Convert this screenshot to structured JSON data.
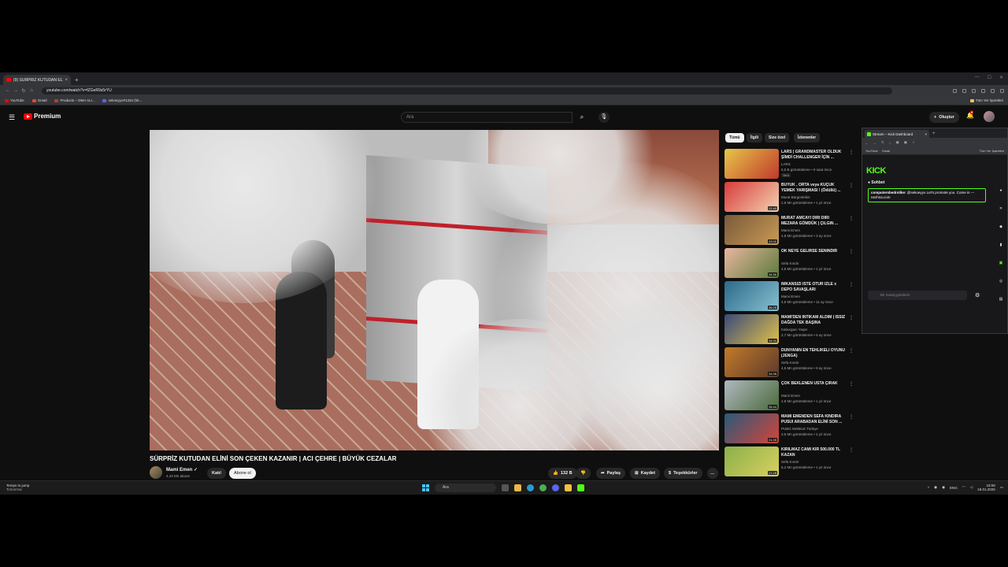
{
  "browser": {
    "tab_title": "(9) SÜRPRİZ KUTUDAN ELİ...",
    "url": "youtube.com/watch?v=fZGeR9s5rYU",
    "bookmarks": [
      "YouTube",
      "Gmail",
      "Products – DMA ALI...",
      "sekoeyyo#1334 (hit..."
    ],
    "bookmarks_right": "Tüm Yer İşaretleri"
  },
  "header": {
    "logo_text": "Premium",
    "search_placeholder": "Ara",
    "create_label": "Oluştur",
    "notif_count": "9"
  },
  "video": {
    "title": "SÜRPRİZ KUTUDAN ELİNİ SON ÇEKEN KAZANIR | ACI ÇEHRE | BÜYÜK CEZALAR",
    "channel": "Mami Emen",
    "subscribers": "4,43 Mn abone",
    "join_label": "Katıl",
    "subscribe_label": "Abone ol",
    "likes": "132 B",
    "share_label": "Paylaş",
    "save_label": "Kaydet",
    "thanks_label": "Teşekkürler"
  },
  "chips": [
    "Tümü",
    "İlgili",
    "Size özel",
    "İzlenenler"
  ],
  "recommendations": [
    {
      "title": "LARS | GRANDMASTER OLDUK ŞİMDİ CHALLENGER İÇİN ...",
      "channel": "LARS",
      "meta": "5,5 B görüntüleme • 9 saat önce",
      "badge": "Yeni",
      "duration": "",
      "colors": [
        "#e8c64a",
        "#c0392b"
      ]
    },
    {
      "title": "BÜYÜK , ORTA veya KÜÇÜK YEMEK YARIŞMASI ! (Ödüllü) ...",
      "channel": "Murat Bürgenlekin",
      "meta": "2,9 Mn görüntüleme • 1 yıl önce",
      "badge": "",
      "duration": "22:40",
      "colors": [
        "#d93b3b",
        "#f2d2b0"
      ]
    },
    {
      "title": "MURAT AMCAYI DİRİ DİRİ MEZARA GÖMDÜK | ÇILGIN ...",
      "channel": "Mami Emen",
      "meta": "4,8 Mn görüntüleme • 3 ay önce",
      "badge": "",
      "duration": "43:11",
      "colors": [
        "#7a5a3a",
        "#c99a55"
      ]
    },
    {
      "title": "OK NEYE GELİRSE SENİNDİR",
      "channel": "Sefa Kındır",
      "meta": "4,8 Mn görüntüleme • 1 yıl önce",
      "badge": "",
      "duration": "34:56",
      "colors": [
        "#e9b7a0",
        "#5a7a3a"
      ]
    },
    {
      "title": "İMKANSIZI İSTE OTUR İZLE x DEPO SAVAŞLARI",
      "channel": "Mami Emen",
      "meta": "4,5 Mn görüntüleme • 11 ay önce",
      "badge": "",
      "duration": "36:29",
      "colors": [
        "#2a6a8a",
        "#88c0d0"
      ]
    },
    {
      "title": "MAMİ'DEN İNTİKAM ALDIM | ISSIZ DAĞDA TEK BAŞINA",
      "channel": "Kaburgacı Yaşar",
      "meta": "2,7 Mn görüntüleme • 6 ay önce",
      "badge": "",
      "duration": "34:04",
      "colors": [
        "#3a4a7a",
        "#e2c14a"
      ]
    },
    {
      "title": "DÜNYANIN EN TEHLİKELİ OYUNU (JENGA)",
      "channel": "Sefa Kındır",
      "meta": "4,5 Mn görüntüleme • 9 ay önce",
      "badge": "",
      "duration": "34:08",
      "colors": [
        "#c47a2a",
        "#5a3a2a"
      ]
    },
    {
      "title": "ÇOK BEKLENEN USTA ÇIRAK",
      "channel": "Mami Emen",
      "meta": "4,9 Mn görüntüleme • 1 yıl önce",
      "badge": "",
      "duration": "36:44",
      "colors": [
        "#b0b8c0",
        "#4a6a3a"
      ]
    },
    {
      "title": "MAMİ EMENDEN SEFA KINDIRA PUSUI ARABADAN ELİNİ SON ...",
      "channel": "PUBG MOBILE Türkiye",
      "meta": "3,5 Mn görüntüleme • 2 yıl önce",
      "badge": "",
      "duration": "31:05",
      "colors": [
        "#2a5a7a",
        "#d4443a"
      ]
    },
    {
      "title": "KIRILMAZ CAMI KIR 500.000 TL KAZAN",
      "channel": "Sefa Kındır",
      "meta": "5,2 Mn görüntüleme • 1 yıl önce",
      "badge": "",
      "duration": "21:28",
      "colors": [
        "#8ab04a",
        "#d9d060"
      ]
    }
  ],
  "kick": {
    "tab_title": "Stream – Kick Dashboard",
    "logo": "KICK",
    "chat_header": "Sohbet",
    "message_user": "computersbedrolike:",
    "message_text": "@sekoeyyo Let's promote you. Come in ---nezhna.com",
    "input_placeholder": "Bir mesaj gönderin",
    "bookmarks": [
      "YouTube",
      "Gmail"
    ],
    "bookmarks_right": "Tüm Yer İşaretleri"
  },
  "taskbar": {
    "weather_line1": "Temps to jump",
    "weather_line2": "Tomorrow",
    "search_placeholder": "Ara",
    "lang": "ENG",
    "time": "18:08",
    "date": "18.01.2026"
  },
  "colors": {
    "yt_bg": "#0f0f0f",
    "yt_red": "#ff0000",
    "kick_green": "#53fc18",
    "win_blue": "#4cc2ff"
  }
}
